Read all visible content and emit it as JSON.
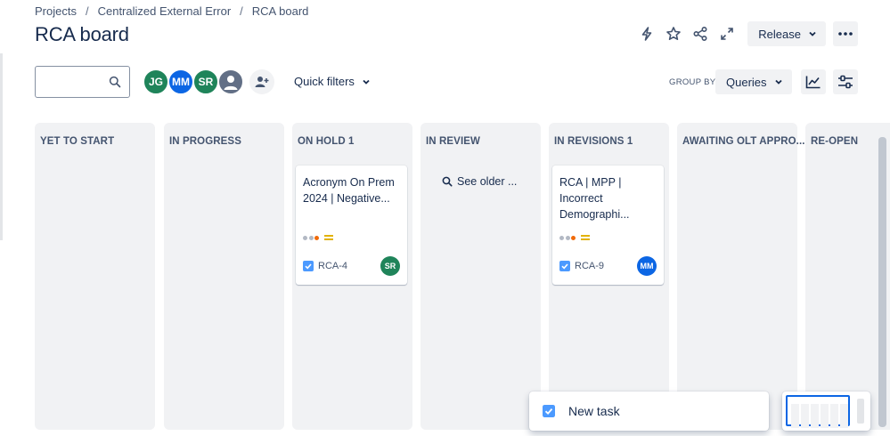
{
  "breadcrumb": {
    "items": [
      "Projects",
      "Centralized External Error",
      "RCA board"
    ],
    "separator": "/"
  },
  "page": {
    "title": "RCA board"
  },
  "header": {
    "icons": [
      "lightning-icon",
      "star-icon",
      "share-icon",
      "expand-icon"
    ],
    "release_label": "Release",
    "more_icon": "ellipsis-icon"
  },
  "toolbar": {
    "search_placeholder": "",
    "avatars": [
      {
        "initials": "JG",
        "color": "#1f845a"
      },
      {
        "initials": "MM",
        "color": "#0c66e4"
      },
      {
        "initials": "SR",
        "color": "#1f845a"
      },
      {
        "initials": "",
        "color": "#626f86"
      }
    ],
    "quick_filters_label": "Quick filters",
    "group_by_label": "GROUP BY",
    "group_by_value": "Queries"
  },
  "columns": [
    {
      "title": "YET TO START"
    },
    {
      "title": "IN PROGRESS"
    },
    {
      "title": "ON HOLD 1"
    },
    {
      "title": "IN REVIEW",
      "see_older_label": "See older ..."
    },
    {
      "title": "IN REVISIONS 1"
    },
    {
      "title": "AWAITING OLT APPRO..."
    },
    {
      "title": "RE-OPEN"
    }
  ],
  "cards": [
    {
      "title": "Acronym On Prem 2024 | Negative...",
      "key": "RCA-4",
      "assignee": "SR",
      "assignee_color": "#1f845a",
      "priority": "medium"
    },
    {
      "title": "RCA | MPP | Incorrect Demographi...",
      "key": "RCA-9",
      "assignee": "MM",
      "assignee_color": "#0c66e4",
      "priority": "medium"
    }
  ],
  "colors": {
    "accent_blue": "#0c66e4",
    "column_bg": "#f1f2f4",
    "priority_medium": "#e2b203",
    "task_checkbox": "#4c9aff"
  },
  "new_task": {
    "label": "New task"
  }
}
